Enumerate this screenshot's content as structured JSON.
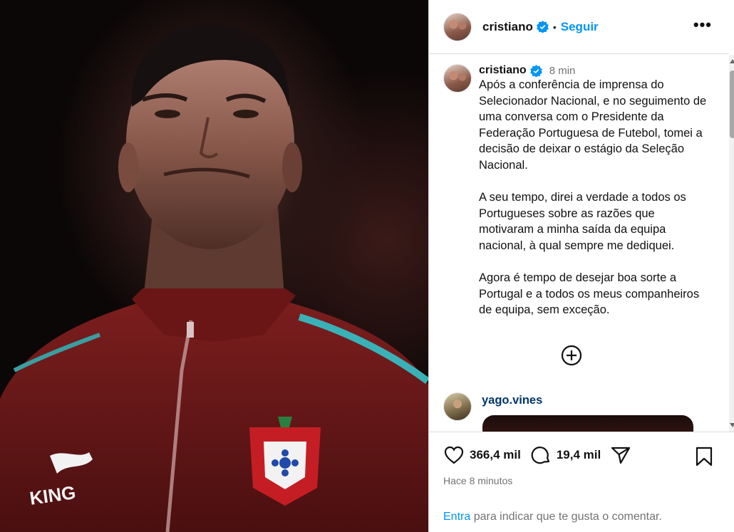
{
  "post": {
    "username": "cristiano",
    "separator": "•",
    "follow_label": "Seguir",
    "more_label": "•••",
    "time_ago": "8 min",
    "caption_paragraphs": [
      "Após a conferência de imprensa do Selecionador Nacional, e no seguimento de uma conversa com o Presidente da Federação Portuguesa de Futebol, tomei a decisão de deixar o estágio da Seleção Nacional.",
      "A seu tempo, direi a verdade a todos os Portugueses sobre as razões que motivaram a minha saída da equipa nacional, à qual sempre me dediquei.",
      "Agora é tempo de desejar boa sorte a Portugal e a todos os meus companheiros de equipa, sem exceção."
    ],
    "photo": {
      "jacket_text": "KING"
    }
  },
  "comments": [
    {
      "username": "yago.vines"
    }
  ],
  "actions": {
    "likes": "366,4 mil",
    "comments": "19,4 mil",
    "posted": "Hace 8 minutos"
  },
  "login_prompt": {
    "link": "Entra",
    "text": " para indicar que te gusta o comentar."
  },
  "colors": {
    "accent": "#0095f6",
    "comment_user": "#00376b",
    "muted": "#737373",
    "jacket": "#6e1a1a"
  },
  "icons": [
    "verified-icon",
    "more-icon",
    "add-comment-icon",
    "heart-icon",
    "comment-icon",
    "share-icon",
    "bookmark-icon"
  ]
}
